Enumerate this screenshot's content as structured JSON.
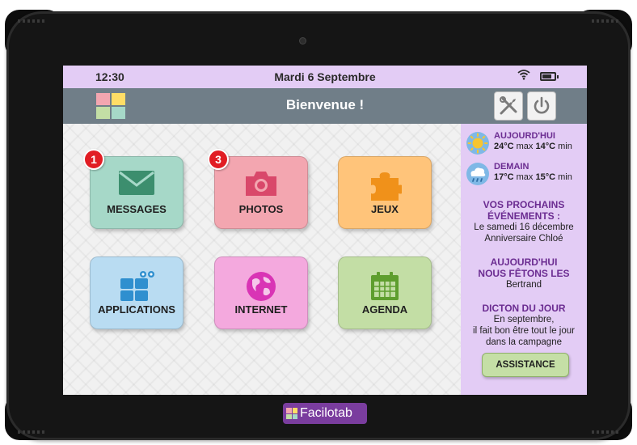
{
  "device": {
    "brand_name": "Facilotab"
  },
  "status_bar": {
    "time": "12:30",
    "date": "Mardi 6 Septembre",
    "battery_level": 0.75
  },
  "header": {
    "title": "Bienvenue !"
  },
  "tiles": [
    {
      "id": "messages",
      "label": "MESSAGES",
      "icon": "envelope-icon",
      "color": "#a6d8c8",
      "badge": "1"
    },
    {
      "id": "photos",
      "label": "PHOTOS",
      "icon": "camera-icon",
      "color": "#f3a6b0",
      "badge": "3"
    },
    {
      "id": "jeux",
      "label": "JEUX",
      "icon": "puzzle-icon",
      "color": "#ffc47a",
      "badge": null
    },
    {
      "id": "applications",
      "label": "APPLICATIONS",
      "icon": "app-grid-icon",
      "color": "#b9dcf2",
      "badge": null
    },
    {
      "id": "internet",
      "label": "INTERNET",
      "icon": "globe-icon",
      "color": "#f4a9de",
      "badge": null
    },
    {
      "id": "agenda",
      "label": "AGENDA",
      "icon": "calendar-icon",
      "color": "#c3dea5",
      "badge": null
    }
  ],
  "sidebar": {
    "today": {
      "label": "AUJOURD'HUI",
      "max_temp": "24°C",
      "max_label": "max",
      "min_temp": "14°C",
      "min_label": "min",
      "icon": "sun-icon"
    },
    "tomorrow": {
      "label": "DEMAIN",
      "max_temp": "17°C",
      "max_label": "max",
      "min_temp": "15°C",
      "min_label": "min",
      "icon": "rain-cloud-icon"
    },
    "events": {
      "title_line1": "VOS PROCHAINS",
      "title_line2": "ÉVÉNEMENTS :",
      "date": "Le samedi 16 décembre",
      "name": "Anniversaire Chloé"
    },
    "name_day": {
      "title_line1": "AUJOURD'HUI",
      "title_line2": "NOUS FÊTONS LES",
      "name": "Bertrand"
    },
    "saying": {
      "title": "DICTON DU JOUR",
      "line1": "En septembre,",
      "line2": "il fait bon être tout le jour",
      "line3": "dans la campagne"
    },
    "assist_label": "ASSISTANCE"
  },
  "colors": {
    "accent_purple": "#6b2c91",
    "status_bar": "#e3ccf5",
    "header": "#707e88",
    "badge_red": "#e11d24"
  }
}
